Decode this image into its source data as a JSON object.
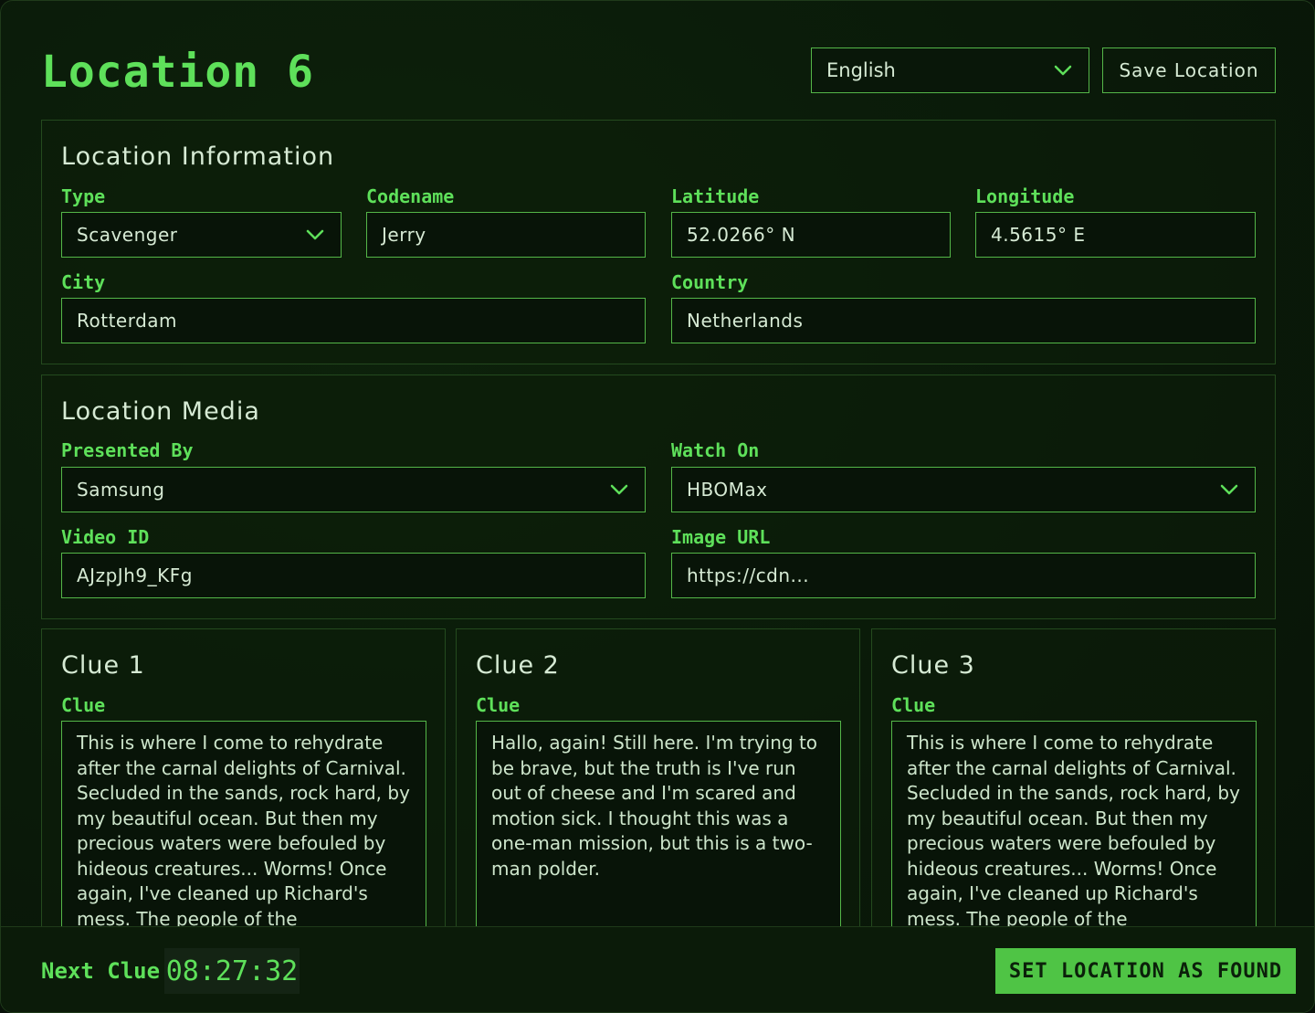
{
  "header": {
    "title": "Location 6",
    "language": "English",
    "save_label": "Save Location"
  },
  "location_info": {
    "title": "Location Information",
    "type_label": "Type",
    "type_value": "Scavenger",
    "codename_label": "Codename",
    "codename_value": "Jerry",
    "latitude_label": "Latitude",
    "latitude_value": "52.0266° N",
    "longitude_label": "Longitude",
    "longitude_value": "4.5615° E",
    "city_label": "City",
    "city_value": "Rotterdam",
    "country_label": "Country",
    "country_value": "Netherlands"
  },
  "location_media": {
    "title": "Location Media",
    "presented_by_label": "Presented By",
    "presented_by_value": "Samsung",
    "watch_on_label": "Watch On",
    "watch_on_value": "HBOMax",
    "video_id_label": "Video ID",
    "video_id_value": "AJzpJh9_KFg",
    "image_url_label": "Image URL",
    "image_url_value": "https://cdn..."
  },
  "clues": [
    {
      "title": "Clue 1",
      "label": "Clue",
      "text": "This is where I come to rehydrate after the carnal delights of Carnival. Secluded in the sands, rock hard, by my beautiful ocean. But then my precious waters were befouled by hideous creatures... Worms! Once again, I've cleaned up Richard's mess. The people of the"
    },
    {
      "title": "Clue 2",
      "label": "Clue",
      "text": "Hallo, again! Still here. I'm trying to be brave, but the truth is I've run out of cheese and I'm scared and motion sick. I thought this was a one-man mission, but this is a two-man polder."
    },
    {
      "title": "Clue 3",
      "label": "Clue",
      "text": "This is where I come to rehydrate after the carnal delights of Carnival. Secluded in the sands, rock hard, by my beautiful ocean. But then my precious waters were befouled by hideous creatures... Worms! Once again, I've cleaned up Richard's mess. The people of the"
    }
  ],
  "footer": {
    "next_clue_label": "Next Clue",
    "timer": "08:27:32",
    "found_button": "SET LOCATION AS FOUND"
  },
  "colors": {
    "accent": "#5ee05a",
    "border": "#54b648",
    "background": "#0a1a09",
    "button_fill": "#4fc445"
  },
  "icons": {
    "dropdown": "chevron-down-icon"
  }
}
